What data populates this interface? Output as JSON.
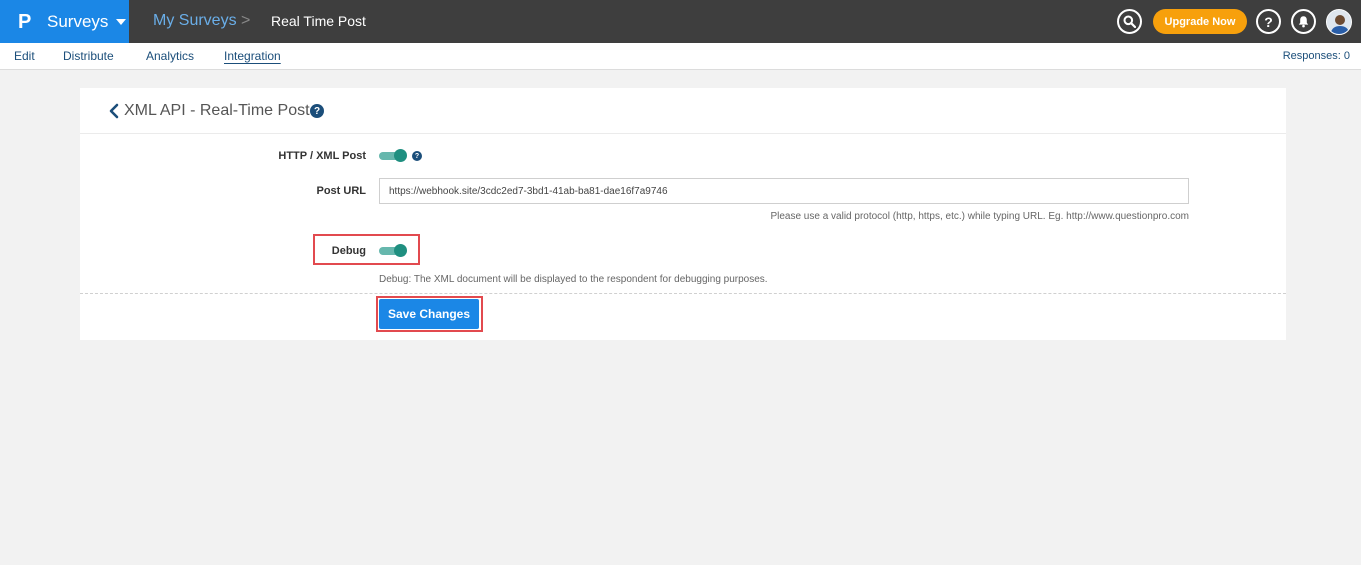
{
  "app": {
    "name": "Surveys",
    "logo_letter": "P",
    "brand_color": "#1b87e6"
  },
  "breadcrumb": {
    "parent": "My Surveys",
    "separator": ">",
    "current": "Real Time Post"
  },
  "header_actions": {
    "search_icon": "search-icon",
    "upgrade_label": "Upgrade Now",
    "upgrade_color": "#f7a00c",
    "help_glyph": "?",
    "bell_icon": "bell-icon",
    "avatar_icon": "user-avatar"
  },
  "tabs": [
    {
      "label": "Edit",
      "active": false
    },
    {
      "label": "Distribute",
      "active": false
    },
    {
      "label": "Analytics",
      "active": false
    },
    {
      "label": "Integration",
      "active": true
    }
  ],
  "responses_label": "Responses: 0",
  "panel": {
    "title": "XML API - Real-Time Post",
    "help_glyph": "?"
  },
  "form": {
    "http_post": {
      "label": "HTTP / XML Post",
      "enabled": true,
      "help_glyph": "?"
    },
    "post_url": {
      "label": "Post URL",
      "value": "https://webhook.site/3cdc2ed7-3bd1-41ab-ba81-dae16f7a9746",
      "hint": "Please use a valid protocol (http, https, etc.) while typing URL. Eg. http://www.questionpro.com"
    },
    "debug": {
      "label": "Debug",
      "enabled": true,
      "hint": "Debug: The XML document will be displayed to the respondent for debugging purposes."
    },
    "save_label": "Save Changes"
  },
  "colors": {
    "toggle_on": "#1f8f80",
    "highlight": "#e24a4f",
    "topbar": "#3e3e3e"
  }
}
